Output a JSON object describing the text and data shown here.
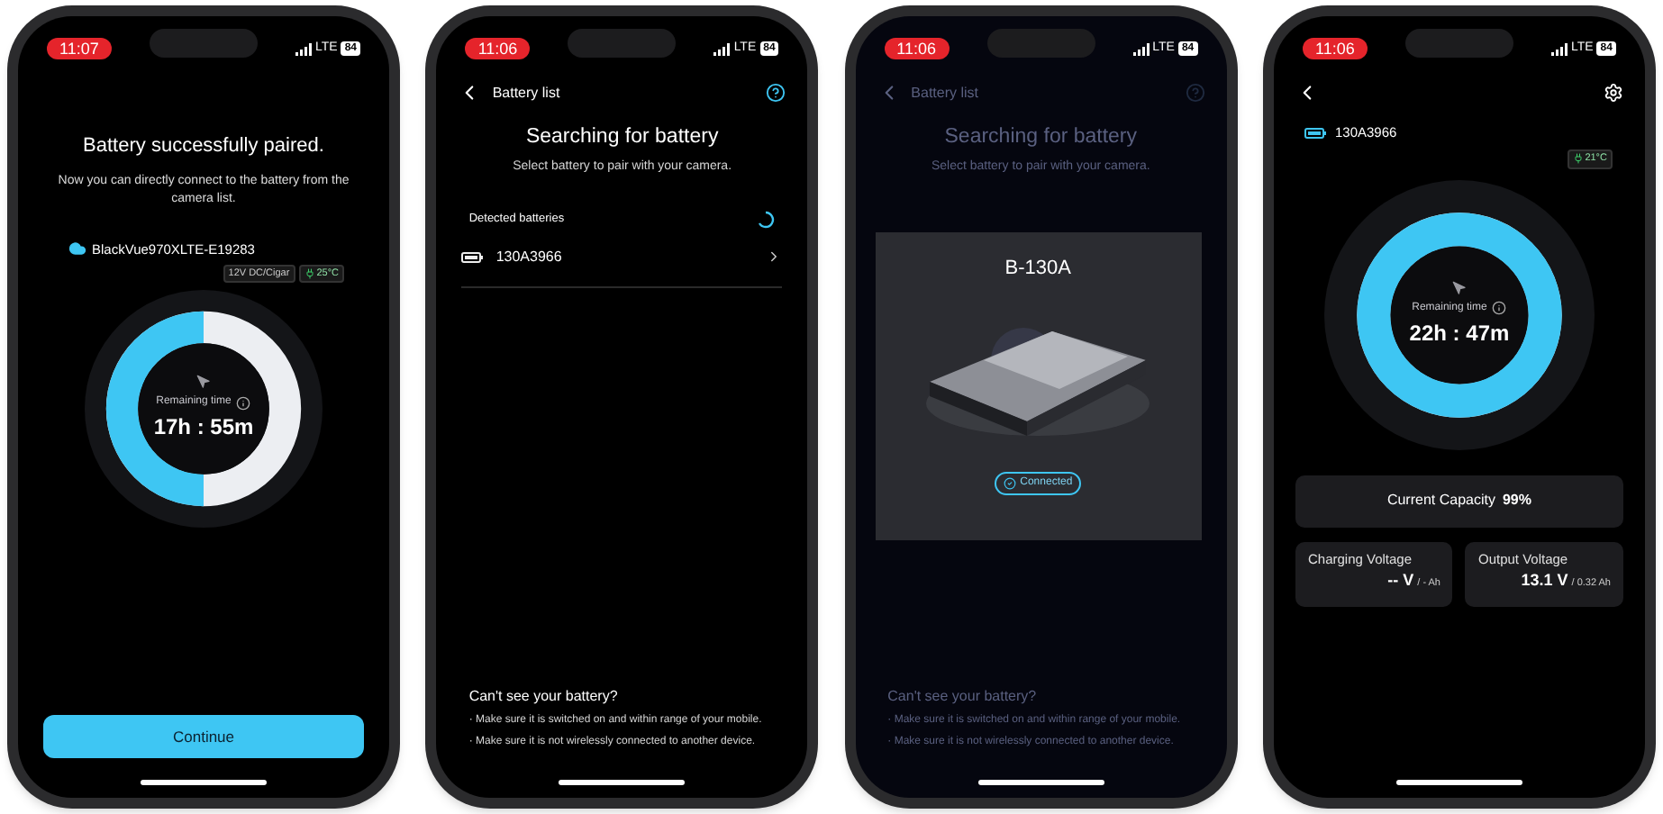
{
  "phones": [
    {
      "kind": "paired",
      "status": {
        "time": "11:07",
        "network": "LTE",
        "battery": "84"
      },
      "title": "Battery successfully paired.",
      "message": "Now you can directly connect to the battery from the camera list.",
      "device": "BlackVue970XLTE-E19283",
      "tags": [
        {
          "kind": "source",
          "text": "12V DC/Cigar"
        },
        {
          "kind": "temperature",
          "text": "25°C"
        }
      ],
      "gauge": {
        "label": "Remaining time",
        "value": "17h : 55m",
        "level": 0.5
      },
      "button": "Continue"
    },
    {
      "kind": "list",
      "status": {
        "time": "11:06",
        "network": "LTE",
        "battery": "84"
      },
      "header": "Battery list",
      "title": "Searching for battery",
      "subtitle": "Select battery to pair with your camera.",
      "section": "Detected batteries",
      "batteries": [
        "130A3966"
      ],
      "help": {
        "title": "Can't see your battery?",
        "tips": [
          "· Make sure it is switched on and within range of your mobile.",
          "· Make sure it is not wirelessly connected to another device."
        ]
      }
    },
    {
      "kind": "popup",
      "status": {
        "time": "11:06",
        "network": "LTE",
        "battery": "84"
      },
      "header": "Battery list",
      "title": "Searching for battery",
      "subtitle": "Select battery to pair with your camera.",
      "dialog": {
        "title": "B-130A",
        "status": "Connected"
      },
      "help": {
        "title": "Can't see your battery?",
        "tips": [
          "· Make sure it is switched on and within range of your mobile.",
          "· Make sure it is not wirelessly connected to another device."
        ]
      }
    },
    {
      "kind": "detail",
      "status": {
        "time": "11:06",
        "network": "LTE",
        "battery": "84"
      },
      "battery": "130A3966",
      "temperature": "21°C",
      "gauge": {
        "label": "Remaining time",
        "value": "22h : 47m",
        "level": 1
      },
      "capacity": {
        "label": "Current Capacity",
        "value": "99%"
      },
      "readings": [
        {
          "label": "Charging Voltage",
          "value": "-- V",
          "unit": "/ - Ah"
        },
        {
          "label": "Output Voltage",
          "value": "13.1 V",
          "unit": "/ 0.32 Ah"
        }
      ]
    }
  ]
}
